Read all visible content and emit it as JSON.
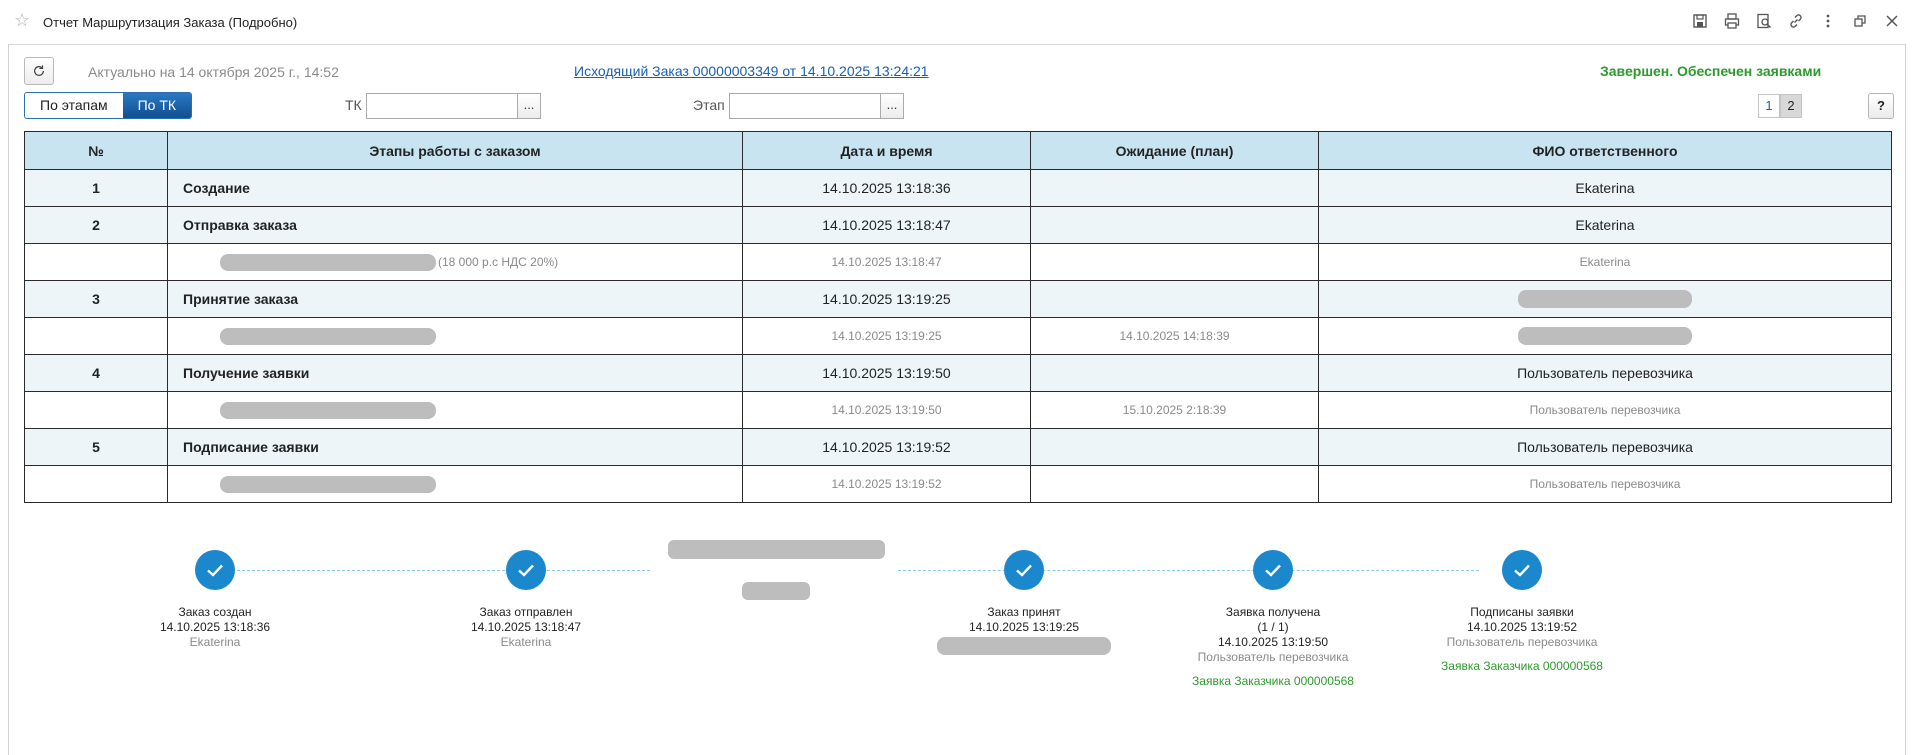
{
  "window": {
    "title": "Отчет Маршрутизация Заказа (Подробно)",
    "icons": [
      "star-icon",
      "save-icon",
      "print-icon",
      "preview-icon",
      "link-icon",
      "more-icon",
      "restore-icon",
      "close-icon"
    ]
  },
  "header": {
    "actual": "Актуально на 14 октября 2025 г., 14:52",
    "order_link": "Исходящий Заказ 00000003349 от 14.10.2025 13:24:21",
    "status": "Завершен. Обеспечен заявками",
    "status_color": "#2d9a2d"
  },
  "toolbar": {
    "mode_by_stages": "По этапам",
    "mode_by_tk": "По ТК",
    "active_mode": "По ТК",
    "tk_label": "ТК",
    "tk_value": "",
    "stage_label": "Этап",
    "stage_value": "",
    "select_button": "...",
    "pages": [
      "1",
      "2"
    ],
    "help": "?"
  },
  "table": {
    "columns": [
      "№",
      "Этапы работы с заказом",
      "Дата и время",
      "Ожидание (план)",
      "ФИО ответственного"
    ],
    "rows": [
      {
        "kind": "main",
        "num": "1",
        "stage": "Создание",
        "datetime": "14.10.2025 13:18:36",
        "wait": "",
        "person": "Ekaterina"
      },
      {
        "kind": "main",
        "num": "2",
        "stage": "Отправка заказа",
        "datetime": "14.10.2025 13:18:47",
        "wait": "",
        "person": "Ekaterina"
      },
      {
        "kind": "sub",
        "num": "",
        "stage_note": "(18 000 р.с НДС 20%)",
        "datetime": "14.10.2025 13:18:47",
        "wait": "",
        "person": "Ekaterina"
      },
      {
        "kind": "main",
        "num": "3",
        "stage": "Принятие заказа",
        "datetime": "14.10.2025 13:19:25",
        "wait": "",
        "person": ""
      },
      {
        "kind": "sub",
        "num": "",
        "stage_note": "",
        "datetime": "14.10.2025 13:19:25",
        "wait": "14.10.2025 14:18:39",
        "person": ""
      },
      {
        "kind": "main",
        "num": "4",
        "stage": "Получение заявки",
        "datetime": "14.10.2025 13:19:50",
        "wait": "",
        "person": "Пользователь перевозчика"
      },
      {
        "kind": "sub",
        "num": "",
        "stage_note": "",
        "datetime": "14.10.2025 13:19:50",
        "wait": "15.10.2025 2:18:39",
        "person": "Пользователь перевозчика"
      },
      {
        "kind": "main",
        "num": "5",
        "stage": "Подписание заявки",
        "datetime": "14.10.2025 13:19:52",
        "wait": "",
        "person": "Пользователь перевозчика"
      },
      {
        "kind": "sub",
        "num": "",
        "stage_note": "",
        "datetime": "14.10.2025 13:19:52",
        "wait": "",
        "person": "Пользователь перевозчика"
      }
    ]
  },
  "timeline": {
    "accent_color": "#1b87cc",
    "nodes": [
      {
        "title": "Заказ создан",
        "datetime": "14.10.2025 13:18:36",
        "person": "Ekaterina"
      },
      {
        "title": "Заказ отправлен",
        "datetime": "14.10.2025 13:18:47",
        "person": "Ekaterina"
      },
      {
        "title": "Заказ принят",
        "datetime": "14.10.2025 13:19:25",
        "person": ""
      },
      {
        "title": "Заявка получена",
        "count": "(1 / 1)",
        "datetime": "14.10.2025 13:19:50",
        "person": "Пользователь перевозчика",
        "link": "Заявка Заказчика 000000568"
      },
      {
        "title": "Подписаны заявки",
        "datetime": "14.10.2025 13:19:52",
        "person": "Пользователь перевозчика",
        "link": "Заявка Заказчика 000000568"
      }
    ]
  }
}
